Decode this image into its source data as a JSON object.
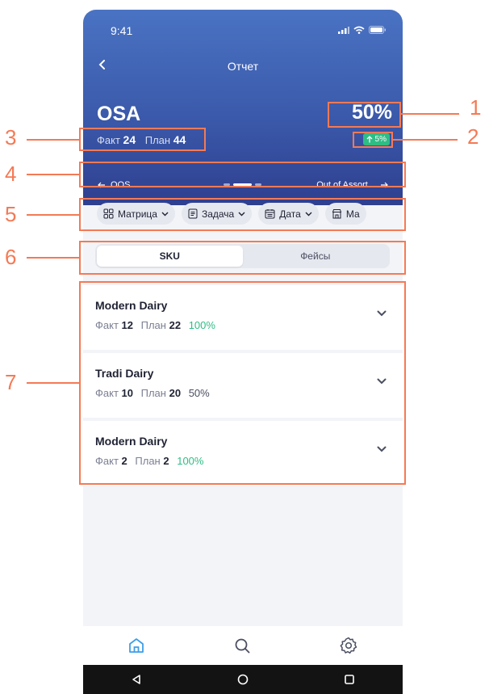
{
  "status_bar": {
    "time": "9:41"
  },
  "header": {
    "title": "Отчет",
    "metric": "OSA",
    "fact_label": "Факт",
    "fact_value": "24",
    "plan_label": "План",
    "plan_value": "44",
    "percent": "50%",
    "delta": "5%",
    "prev_metric": "OOS",
    "next_metric": "Out of Assort...",
    "colors": {
      "header_top": "#4a73c3",
      "header_bottom": "#2f3f8f",
      "positive": "#2ebd85",
      "annotation": "#f47a55"
    }
  },
  "filters": [
    {
      "label": "Матрица",
      "icon": "grid-icon"
    },
    {
      "label": "Задача",
      "icon": "document-icon"
    },
    {
      "label": "Дата",
      "icon": "calendar-icon"
    },
    {
      "label": "Ма",
      "icon": "store-icon"
    }
  ],
  "tabs": {
    "sku": "SKU",
    "faces": "Фейсы",
    "active": "SKU"
  },
  "items": [
    {
      "title": "Modern Dairy",
      "fact_label": "Факт",
      "fact": "12",
      "plan_label": "План",
      "plan": "22",
      "percent": "100%",
      "status": "good"
    },
    {
      "title": "Tradi Dairy",
      "fact_label": "Факт",
      "fact": "10",
      "plan_label": "План",
      "plan": "20",
      "percent": "50%",
      "status": "neutral"
    },
    {
      "title": "Modern Dairy",
      "fact_label": "Факт",
      "fact": "2",
      "plan_label": "План",
      "plan": "2",
      "percent": "100%",
      "status": "good"
    }
  ],
  "bottom_nav": [
    "home-icon",
    "search-icon",
    "settings-icon"
  ],
  "annotations": [
    "1",
    "2",
    "3",
    "4",
    "5",
    "6",
    "7"
  ]
}
